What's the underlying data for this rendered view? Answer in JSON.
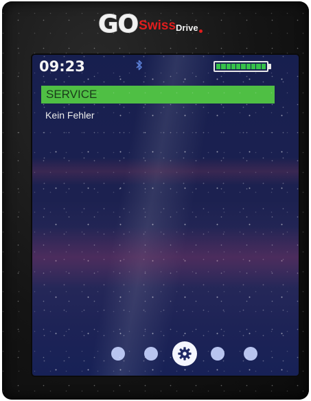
{
  "device": {
    "brand_go": "GO",
    "brand_swiss": "Swiss",
    "brand_drive": "Drive"
  },
  "status": {
    "time": "09:23",
    "bluetooth_icon": "bluetooth-icon",
    "battery_level": 1.0,
    "battery_color": "#36c24a"
  },
  "screen": {
    "title": "SERVICE",
    "message": "Kein Fehler",
    "header_color": "#4fbf44"
  },
  "nav": {
    "pages": 5,
    "active_index": 2,
    "active_icon": "gear-icon"
  }
}
